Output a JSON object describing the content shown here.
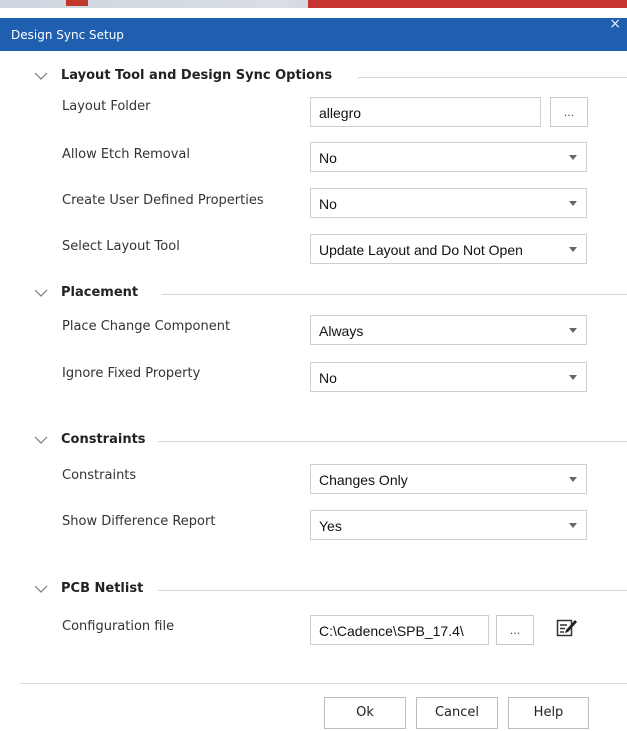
{
  "window": {
    "title": "Design Sync Setup",
    "close_glyph": "×"
  },
  "sections": {
    "layout": {
      "title": "Layout Tool and Design Sync Options",
      "layout_folder": {
        "label": "Layout Folder",
        "value": "allegro",
        "browse": "..."
      },
      "allow_etch_removal": {
        "label": "Allow Etch Removal",
        "value": "No"
      },
      "create_user_defined_properties": {
        "label": "Create User Defined Properties",
        "value": "No"
      },
      "select_layout_tool": {
        "label": "Select Layout Tool",
        "value": "Update Layout and Do Not Open"
      }
    },
    "placement": {
      "title": "Placement",
      "place_change_component": {
        "label": "Place Change Component",
        "value": "Always"
      },
      "ignore_fixed_property": {
        "label": "Ignore Fixed Property",
        "value": "No"
      }
    },
    "constraints": {
      "title": "Constraints",
      "constraints": {
        "label": "Constraints",
        "value": "Changes Only"
      },
      "show_difference_report": {
        "label": "Show Difference Report",
        "value": "Yes"
      }
    },
    "pcb_netlist": {
      "title": "PCB Netlist",
      "configuration_file": {
        "label": "Configuration file",
        "value": "C:\\Cadence\\SPB_17.4\\",
        "browse": "..."
      }
    }
  },
  "buttons": {
    "ok": "Ok",
    "cancel": "Cancel",
    "help": "Help"
  },
  "icons": {
    "chevron": "chevron-down-icon",
    "edit": "edit-icon",
    "close": "close-icon"
  },
  "colors": {
    "titlebar": "#1e5fb0",
    "background": "#ffffff",
    "border": "#cfcfcf"
  }
}
